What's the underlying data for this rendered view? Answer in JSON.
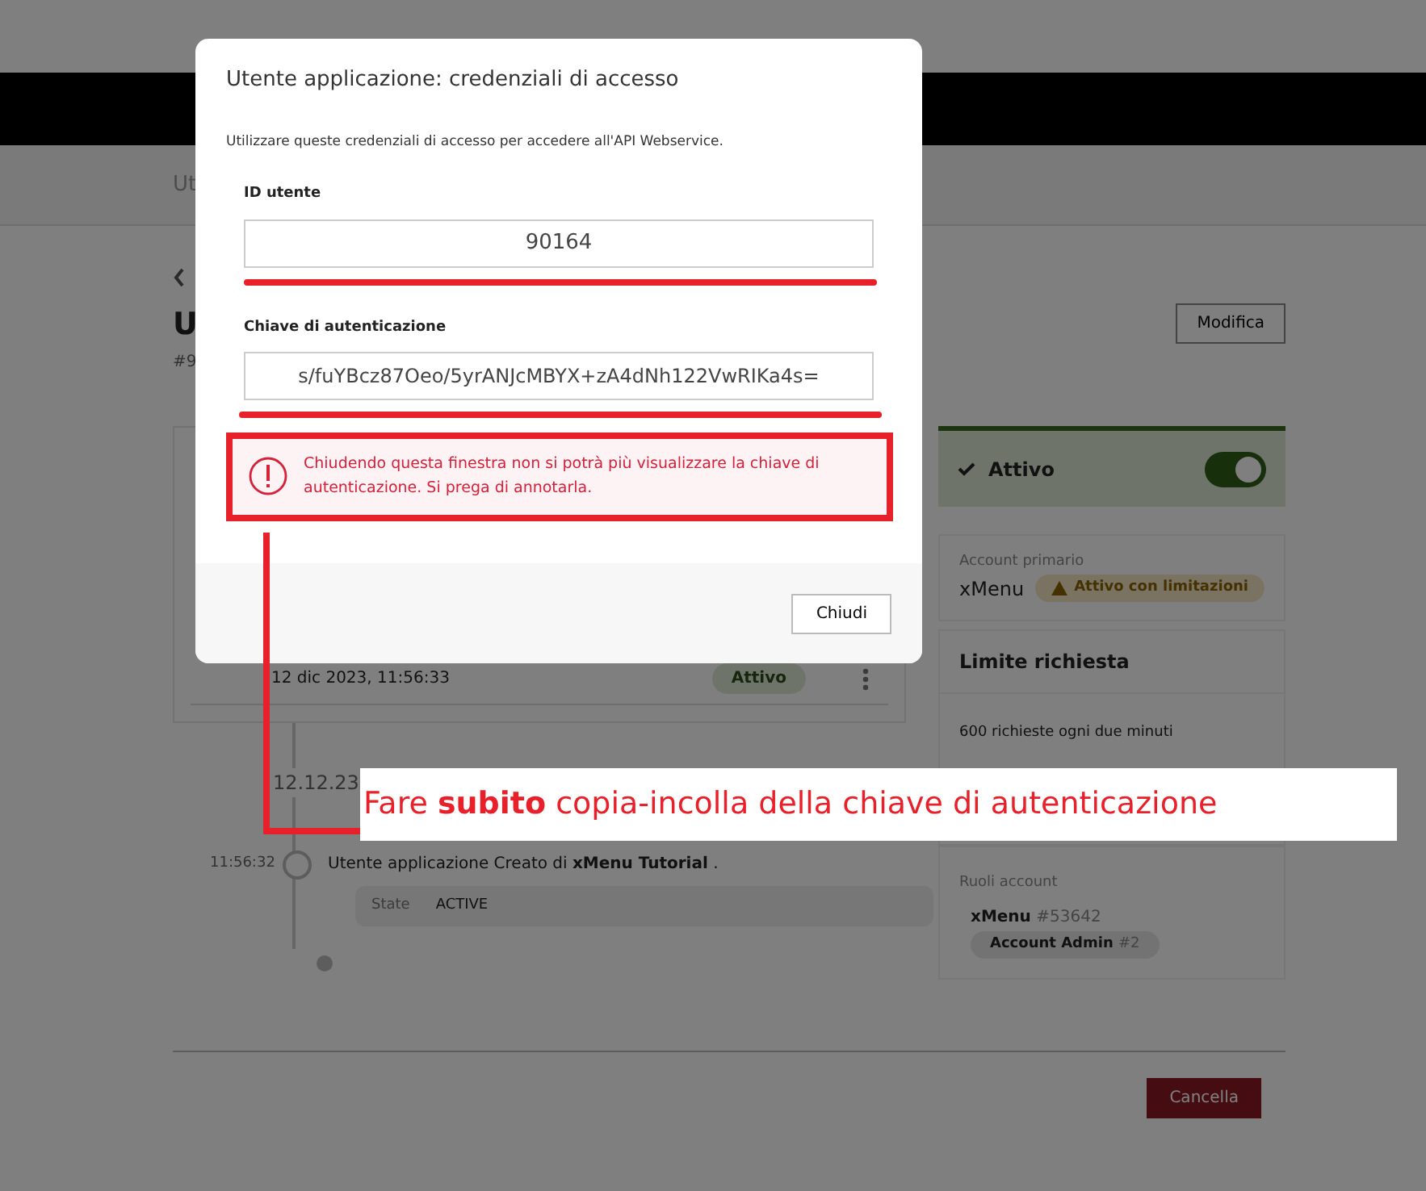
{
  "header": {
    "breadcrumb": "Ut"
  },
  "page": {
    "title": "U",
    "subtitle": "#9",
    "edit_button": "Modifica",
    "history_row": {
      "date": "12 dic 2023, 11:56:33",
      "status": "Attivo"
    },
    "timeline": {
      "date": "12.12.23",
      "events": [
        {
          "time": "11:56:32",
          "text": "Utente applicazione Creato di **xMenu Tutorial** .",
          "details": [
            {
              "key": "State",
              "value": "ACTIVE"
            }
          ]
        }
      ]
    },
    "cancel_button": "Cancella"
  },
  "sidebar": {
    "status": {
      "label": "Attivo",
      "on": true
    },
    "primary_account": {
      "label": "Account primario",
      "value": "xMenu",
      "badge": "Attivo con limitazioni"
    },
    "rate_limit": {
      "title": "Limite richiesta",
      "text": "600 richieste ogni due minuti"
    },
    "roles": {
      "title": "Ruoli account",
      "account": "xMenu",
      "account_id": "#53642",
      "role": "Account Admin",
      "role_id": "#2"
    }
  },
  "modal": {
    "title": "Utente applicazione: credenziali di accesso",
    "intro": "Utilizzare queste credenziali di accesso per accedere all'API Webservice.",
    "fields": [
      {
        "label": "ID utente",
        "value": "90164"
      },
      {
        "label": "Chiave di autenticazione",
        "value": "s/fuYBcz87Oeo/5yrANJcMBYX+zA4dNh122VwRIKa4s="
      }
    ],
    "warning": "Chiudendo questa finestra non si potrà più visualizzare la chiave di autenticazione. Si prega di annotarla.",
    "close_button": "Chiudi"
  },
  "annotation": {
    "text": "Fare **subito** copia-incolla della chiave di autenticazione"
  }
}
